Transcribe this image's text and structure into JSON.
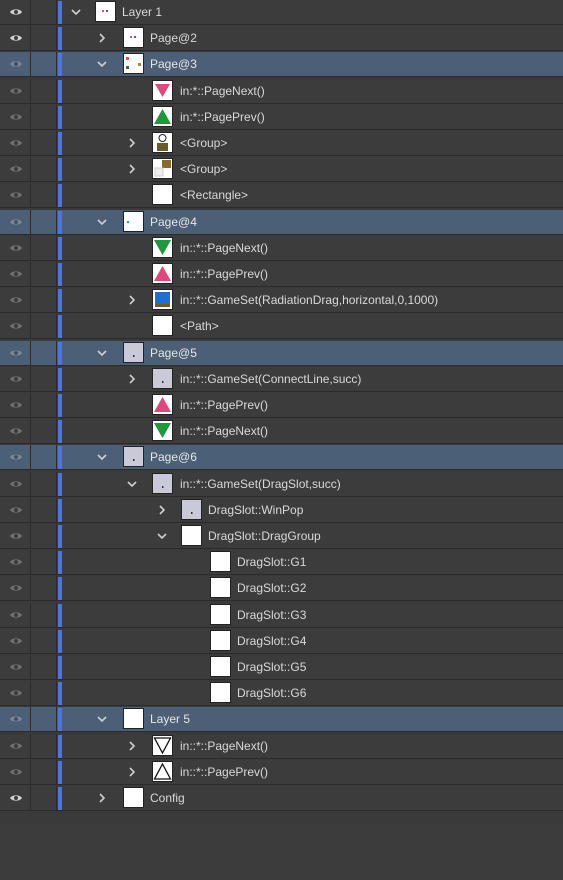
{
  "layers_panel": {
    "rows": [
      {
        "name": "layer-row-layer-1",
        "label": "Layer 1",
        "indent": 0,
        "chevron": "down",
        "thumb": "page-mini",
        "eye": "bright",
        "selected": false
      },
      {
        "name": "layer-row-page-2",
        "label": "Page@2",
        "indent": 1,
        "chevron": "right",
        "thumb": "page-mini",
        "eye": "bright",
        "selected": false
      },
      {
        "name": "layer-row-page-3",
        "label": "Page@3",
        "indent": 1,
        "chevron": "down",
        "thumb": "page-mini-2",
        "eye": "dim",
        "selected": true
      },
      {
        "name": "layer-row-pagenext",
        "label": "in:*::PageNext()",
        "indent": 2,
        "chevron": "none",
        "thumb": "pink-down-triangle",
        "eye": "dim",
        "selected": false
      },
      {
        "name": "layer-row-pageprev",
        "label": "in:*::PagePrev()",
        "indent": 2,
        "chevron": "none",
        "thumb": "green-up-triangle",
        "eye": "dim",
        "selected": false
      },
      {
        "name": "layer-row-group-1",
        "label": "<Group>",
        "indent": 2,
        "chevron": "right",
        "thumb": "group-circle",
        "eye": "dim",
        "selected": false
      },
      {
        "name": "layer-row-group-2",
        "label": "<Group>",
        "indent": 2,
        "chevron": "right",
        "thumb": "group-brown",
        "eye": "dim",
        "selected": false
      },
      {
        "name": "layer-row-rectangle",
        "label": "<Rectangle>",
        "indent": 2,
        "chevron": "none",
        "thumb": "blank",
        "eye": "dim",
        "selected": false
      },
      {
        "name": "layer-row-page-4",
        "label": "Page@4",
        "indent": 1,
        "chevron": "down",
        "thumb": "page-dot-green",
        "eye": "dim",
        "selected": true
      },
      {
        "name": "layer-row-pagenext",
        "label": "in::*::PageNext()",
        "indent": 2,
        "chevron": "none",
        "thumb": "green-down-triangle",
        "eye": "dim",
        "selected": false
      },
      {
        "name": "layer-row-pageprev",
        "label": "in::*::PagePrev()",
        "indent": 2,
        "chevron": "none",
        "thumb": "pink-up-triangle",
        "eye": "dim",
        "selected": false
      },
      {
        "name": "layer-row-gameset-radiation",
        "label": "in::*::GameSet(RadiationDrag,horizontal,0,1000)",
        "indent": 2,
        "chevron": "right",
        "thumb": "blue-block",
        "eye": "dim",
        "selected": false
      },
      {
        "name": "layer-row-path",
        "label": "<Path>",
        "indent": 2,
        "chevron": "none",
        "thumb": "blank",
        "eye": "dim",
        "selected": false
      },
      {
        "name": "layer-row-page-5",
        "label": "Page@5",
        "indent": 1,
        "chevron": "down",
        "thumb": "gray-dot",
        "eye": "dim",
        "selected": true
      },
      {
        "name": "layer-row-gameset-connectline",
        "label": "in::*::GameSet(ConnectLine,succ)",
        "indent": 2,
        "chevron": "right",
        "thumb": "gray-dot",
        "eye": "dim",
        "selected": false
      },
      {
        "name": "layer-row-pageprev",
        "label": "in::*::PagePrev()",
        "indent": 2,
        "chevron": "none",
        "thumb": "pink-up-triangle",
        "eye": "dim",
        "selected": false
      },
      {
        "name": "layer-row-pagenext",
        "label": "in::*::PageNext()",
        "indent": 2,
        "chevron": "none",
        "thumb": "green-down-triangle",
        "eye": "dim",
        "selected": false
      },
      {
        "name": "layer-row-page-6",
        "label": "Page@6",
        "indent": 1,
        "chevron": "down",
        "thumb": "gray-dot",
        "eye": "dim",
        "selected": true
      },
      {
        "name": "layer-row-gameset-dragslot",
        "label": "in::*::GameSet(DragSlot,succ)",
        "indent": 2,
        "chevron": "down",
        "thumb": "gray-dot",
        "eye": "dim",
        "selected": false
      },
      {
        "name": "layer-row-dragslot-winpop",
        "label": "DragSlot::WinPop",
        "indent": 3,
        "chevron": "right",
        "thumb": "gray-dot",
        "eye": "dim",
        "selected": false
      },
      {
        "name": "layer-row-dragslot-draggroup",
        "label": "DragSlot::DragGroup",
        "indent": 3,
        "chevron": "down",
        "thumb": "blank",
        "eye": "dim",
        "selected": false
      },
      {
        "name": "layer-row-dragslot-g1",
        "label": "DragSlot::G1",
        "indent": 4,
        "chevron": "none",
        "thumb": "blank",
        "eye": "dim",
        "selected": false
      },
      {
        "name": "layer-row-dragslot-g2",
        "label": "DragSlot::G2",
        "indent": 4,
        "chevron": "none",
        "thumb": "blank",
        "eye": "dim",
        "selected": false
      },
      {
        "name": "layer-row-dragslot-g3",
        "label": "DragSlot::G3",
        "indent": 4,
        "chevron": "none",
        "thumb": "blank",
        "eye": "dim",
        "selected": false
      },
      {
        "name": "layer-row-dragslot-g4",
        "label": "DragSlot::G4",
        "indent": 4,
        "chevron": "none",
        "thumb": "blank",
        "eye": "dim",
        "selected": false
      },
      {
        "name": "layer-row-dragslot-g5",
        "label": "DragSlot::G5",
        "indent": 4,
        "chevron": "none",
        "thumb": "blank",
        "eye": "dim",
        "selected": false
      },
      {
        "name": "layer-row-dragslot-g6",
        "label": "DragSlot::G6",
        "indent": 4,
        "chevron": "none",
        "thumb": "blank",
        "eye": "dim",
        "selected": false
      },
      {
        "name": "layer-row-layer-5",
        "label": "Layer 5",
        "indent": 1,
        "chevron": "down",
        "thumb": "blank",
        "eye": "dim",
        "selected": true
      },
      {
        "name": "layer-row-pagenext",
        "label": "in::*::PageNext()",
        "indent": 2,
        "chevron": "right",
        "thumb": "outline-down-triangle",
        "eye": "dim",
        "selected": false
      },
      {
        "name": "layer-row-pageprev",
        "label": "in::*::PagePrev()",
        "indent": 2,
        "chevron": "right",
        "thumb": "outline-up-triangle",
        "eye": "dim",
        "selected": false
      },
      {
        "name": "layer-row-config",
        "label": "Config",
        "indent": 1,
        "chevron": "right",
        "thumb": "blank",
        "eye": "bright",
        "selected": false
      }
    ]
  },
  "colors": {
    "panel_bg": "#3c3c3c",
    "selected_row_bg": "#4b5f76",
    "layer_color_bar": "#4d74e0",
    "pink": "#e0487a",
    "green": "#1a9a3a",
    "blue": "#1f6fd1"
  }
}
